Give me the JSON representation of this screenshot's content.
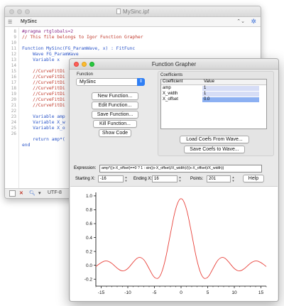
{
  "editor_window": {
    "title": "MySinc.ipf",
    "procedure_selector": "MySinc",
    "line_numbers": [
      "8",
      "9",
      "10",
      "11",
      "12",
      "13",
      "14",
      "15",
      "16",
      "17",
      "18",
      "19",
      "20",
      "21",
      "22",
      "23",
      "24",
      "25",
      "26"
    ],
    "code": {
      "l0": "#pragma rtglobals=2",
      "l1": "// This file belongs to Igor Function Grapher",
      "l3": "Function MySinc(FG_ParamWave, x) : FitFunc",
      "l4": "    Wave FG_ParamWave",
      "l5": "    Variable x",
      "l7": "    //CurveFitDi",
      "l8": "    //CurveFitDi",
      "l9": "    //CurveFitDi",
      "l10": "    //CurveFitDi",
      "l11": "    //CurveFitDi",
      "l12": "    //CurveFitDi",
      "l13": "    //CurveFitDi",
      "l15": "    Variable amp",
      "l16": "    Variable X_w",
      "l17": "    Variable X_o",
      "l19": "    return amp*(",
      "l20": "end"
    },
    "status": {
      "encoding": "UTF-8"
    }
  },
  "grapher_window": {
    "title": "Function Grapher",
    "function_group_label": "Function",
    "function_selected": "MySinc",
    "buttons": {
      "new_function": "New Function...",
      "edit_function": "Edit Function...",
      "save_function": "Save Function...",
      "kill_function": "Kill Function...",
      "show_code": "Show Code",
      "load_coefs": "Load Coefs From Wave...",
      "save_coefs": "Save Coefs to Wave...",
      "help": "Help"
    },
    "coefficients": {
      "group_label": "Coefficients",
      "col_coefficient": "Coefficient",
      "col_value": "Value",
      "rows": [
        {
          "name": "amp",
          "value": "1"
        },
        {
          "name": "X_width",
          "value": "1"
        },
        {
          "name": "X_offset",
          "value": "0.0"
        }
      ]
    },
    "expression": {
      "label": "Expression:",
      "value": "amp*((x-X_offset)==0 ? 1 : sin((x-X_offset)/X_width)/((x-X_offset)/X_width))"
    },
    "range": {
      "start_label": "Starting X:",
      "start_value": "-16",
      "end_label": "Ending X:",
      "end_value": "16",
      "points_label": "Points:",
      "points_value": "201"
    }
  },
  "chart_data": {
    "type": "line",
    "title": "",
    "xlabel": "",
    "ylabel": "",
    "xlim": [
      -16,
      16
    ],
    "ylim": [
      -0.3,
      1.05
    ],
    "x_ticks": [
      -15,
      -10,
      -5,
      0,
      5,
      10,
      15
    ],
    "x_tick_labels": [
      "-15",
      "-10",
      "-5",
      "0",
      "5",
      "10",
      "15"
    ],
    "y_ticks": [
      -0.2,
      0.0,
      0.2,
      0.4,
      0.6,
      0.8,
      1.0
    ],
    "y_tick_labels": [
      "-0.2",
      "0.0",
      "0.2",
      "0.4",
      "0.6",
      "0.8",
      "1.0"
    ],
    "grid": false,
    "series_color": "#e8413a",
    "series": [
      {
        "x": [
          -16,
          -15,
          -14,
          -13,
          -12,
          -11,
          -10,
          -9,
          -8,
          -7,
          -6,
          -5,
          -4,
          -3,
          -2,
          -1,
          0,
          1,
          2,
          3,
          4,
          5,
          6,
          7,
          8,
          9,
          10,
          11,
          12,
          13,
          14,
          15,
          16
        ],
        "y": [
          -0.018,
          0.043,
          0.071,
          0.032,
          -0.045,
          -0.091,
          -0.054,
          0.046,
          0.124,
          0.094,
          -0.047,
          -0.192,
          -0.189,
          0.047,
          0.455,
          0.841,
          1.0,
          0.841,
          0.455,
          0.047,
          -0.189,
          -0.192,
          -0.047,
          0.094,
          0.124,
          0.046,
          -0.054,
          -0.091,
          -0.045,
          0.032,
          0.071,
          0.043,
          -0.018
        ]
      }
    ]
  }
}
